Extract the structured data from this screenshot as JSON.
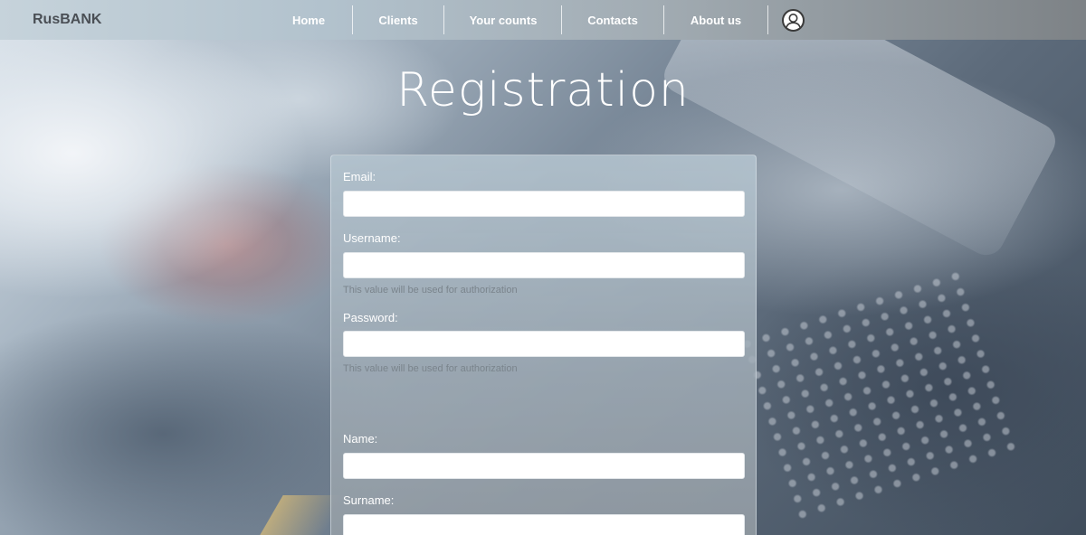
{
  "navbar": {
    "brand": "RusBANK",
    "items": [
      {
        "label": "Home"
      },
      {
        "label": "Clients"
      },
      {
        "label": "Your counts"
      },
      {
        "label": "Contacts"
      },
      {
        "label": "About us"
      }
    ],
    "user_icon": "user-avatar-icon"
  },
  "page": {
    "title": "Registration"
  },
  "form": {
    "fields": [
      {
        "label": "Email:",
        "value": "",
        "placeholder": ""
      },
      {
        "label": "Username:",
        "value": "",
        "placeholder": "",
        "hint": "This value will be used for authorization"
      },
      {
        "label": "Password:",
        "value": "",
        "placeholder": "",
        "hint": "This value will be used for authorization"
      },
      {
        "label": "Name:",
        "value": "",
        "placeholder": ""
      },
      {
        "label": "Surname:",
        "value": "",
        "placeholder": ""
      }
    ]
  },
  "colors": {
    "navbar_start": "#c6d3db",
    "navbar_end": "#7d8286",
    "brand_text": "#4a4f55",
    "hint_text": "#7a848c"
  }
}
